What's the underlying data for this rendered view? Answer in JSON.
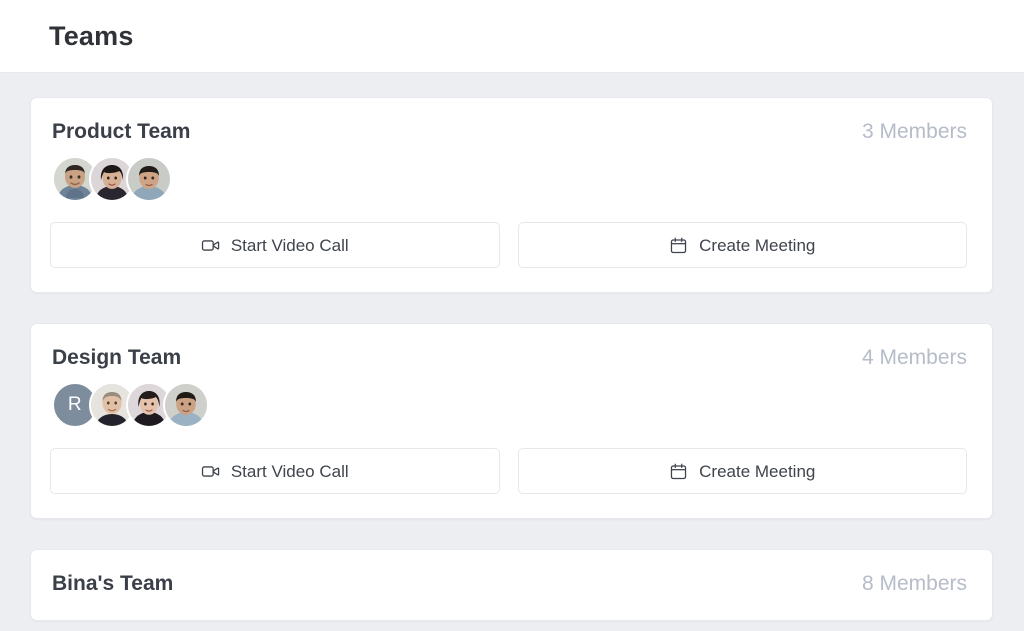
{
  "header": {
    "title": "Teams"
  },
  "teams": [
    {
      "name": "Product Team",
      "member_count_label": "3 Members",
      "avatars": [
        {
          "type": "photo",
          "name": "avatar-photo",
          "skin": "#c9a183",
          "hair": "#2e2722",
          "shirt": "#6e8298",
          "bg": "#d3d7cf"
        },
        {
          "type": "photo",
          "name": "avatar-photo",
          "skin": "#d8b094",
          "hair": "#1d1815",
          "shirt": "#2a2630",
          "bg": "#ddd6d9"
        },
        {
          "type": "photo",
          "name": "avatar-photo",
          "skin": "#cfa385",
          "hair": "#221c18",
          "shirt": "#8fa7b8",
          "bg": "#c9ccc6"
        }
      ],
      "actions": [
        {
          "label": "Start Video Call",
          "icon": "video-camera-icon"
        },
        {
          "label": "Create Meeting",
          "icon": "calendar-icon"
        }
      ]
    },
    {
      "name": "Design Team",
      "member_count_label": "4 Members",
      "avatars": [
        {
          "type": "initial",
          "name": "avatar-initial",
          "initial": "R",
          "color": "#7d8d9d"
        },
        {
          "type": "photo",
          "name": "avatar-photo",
          "skin": "#e1c0a6",
          "hair": "#9a8b7c",
          "shirt": "#24222a",
          "bg": "#e7e3de"
        },
        {
          "type": "photo",
          "name": "avatar-photo",
          "skin": "#e4c2ab",
          "hair": "#241c1a",
          "shirt": "#1e1a20",
          "bg": "#ded7d9"
        },
        {
          "type": "photo",
          "name": "avatar-photo",
          "skin": "#cba283",
          "hair": "#201a16",
          "shirt": "#9ab2c4",
          "bg": "#cfd0cb"
        }
      ],
      "actions": [
        {
          "label": "Start Video Call",
          "icon": "video-camera-icon"
        },
        {
          "label": "Create Meeting",
          "icon": "calendar-icon"
        }
      ]
    },
    {
      "name": "Bina's Team",
      "member_count_label": "8 Members",
      "avatars": [],
      "actions": []
    }
  ],
  "colors": {
    "page_background": "#eceef2",
    "card_background": "#ffffff",
    "card_border": "#e7e9ee",
    "title_text": "#2f3338",
    "muted_text": "#b6bcc8",
    "button_border": "#e6e8ec",
    "avatar_initial_background": "#7d8d9d"
  }
}
